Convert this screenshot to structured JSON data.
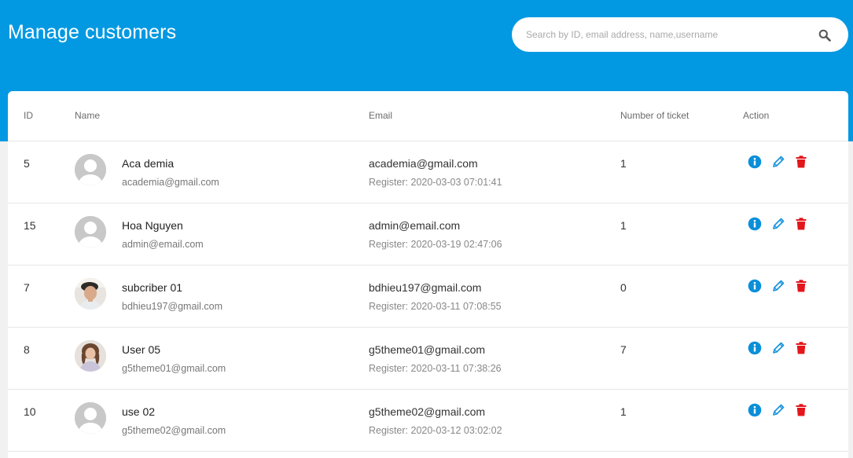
{
  "page": {
    "title": "Manage customers"
  },
  "search": {
    "placeholder": "Search by ID, email address, name,username",
    "value": ""
  },
  "table": {
    "headers": {
      "id": "ID",
      "name": "Name",
      "email": "Email",
      "tickets": "Number of ticket",
      "action": "Action"
    },
    "rows": [
      {
        "id": "5",
        "name": "Aca demia",
        "username": "academia@gmail.com",
        "email": "academia@gmail.com",
        "register": "Register: 2020-03-03 07:01:41",
        "tickets": "1",
        "avatar": "default"
      },
      {
        "id": "15",
        "name": "Hoa Nguyen",
        "username": "admin@email.com",
        "email": "admin@email.com",
        "register": "Register: 2020-03-19 02:47:06",
        "tickets": "1",
        "avatar": "default"
      },
      {
        "id": "7",
        "name": "subcriber 01",
        "username": "bdhieu197@gmail.com",
        "email": "bdhieu197@gmail.com",
        "register": "Register: 2020-03-11 07:08:55",
        "tickets": "0",
        "avatar": "photo-man"
      },
      {
        "id": "8",
        "name": "User 05",
        "username": "g5theme01@gmail.com",
        "email": "g5theme01@gmail.com",
        "register": "Register: 2020-03-11 07:38:26",
        "tickets": "7",
        "avatar": "photo-woman"
      },
      {
        "id": "10",
        "name": "use 02",
        "username": "g5theme02@gmail.com",
        "email": "g5theme02@gmail.com",
        "register": "Register: 2020-03-12 03:02:02",
        "tickets": "1",
        "avatar": "default"
      }
    ]
  },
  "actions": {
    "info": "info-icon",
    "edit": "pencil-icon",
    "delete": "trash-icon"
  },
  "colors": {
    "header": "#0399e2",
    "info": "#0a8fd9",
    "delete": "#e3161b"
  }
}
